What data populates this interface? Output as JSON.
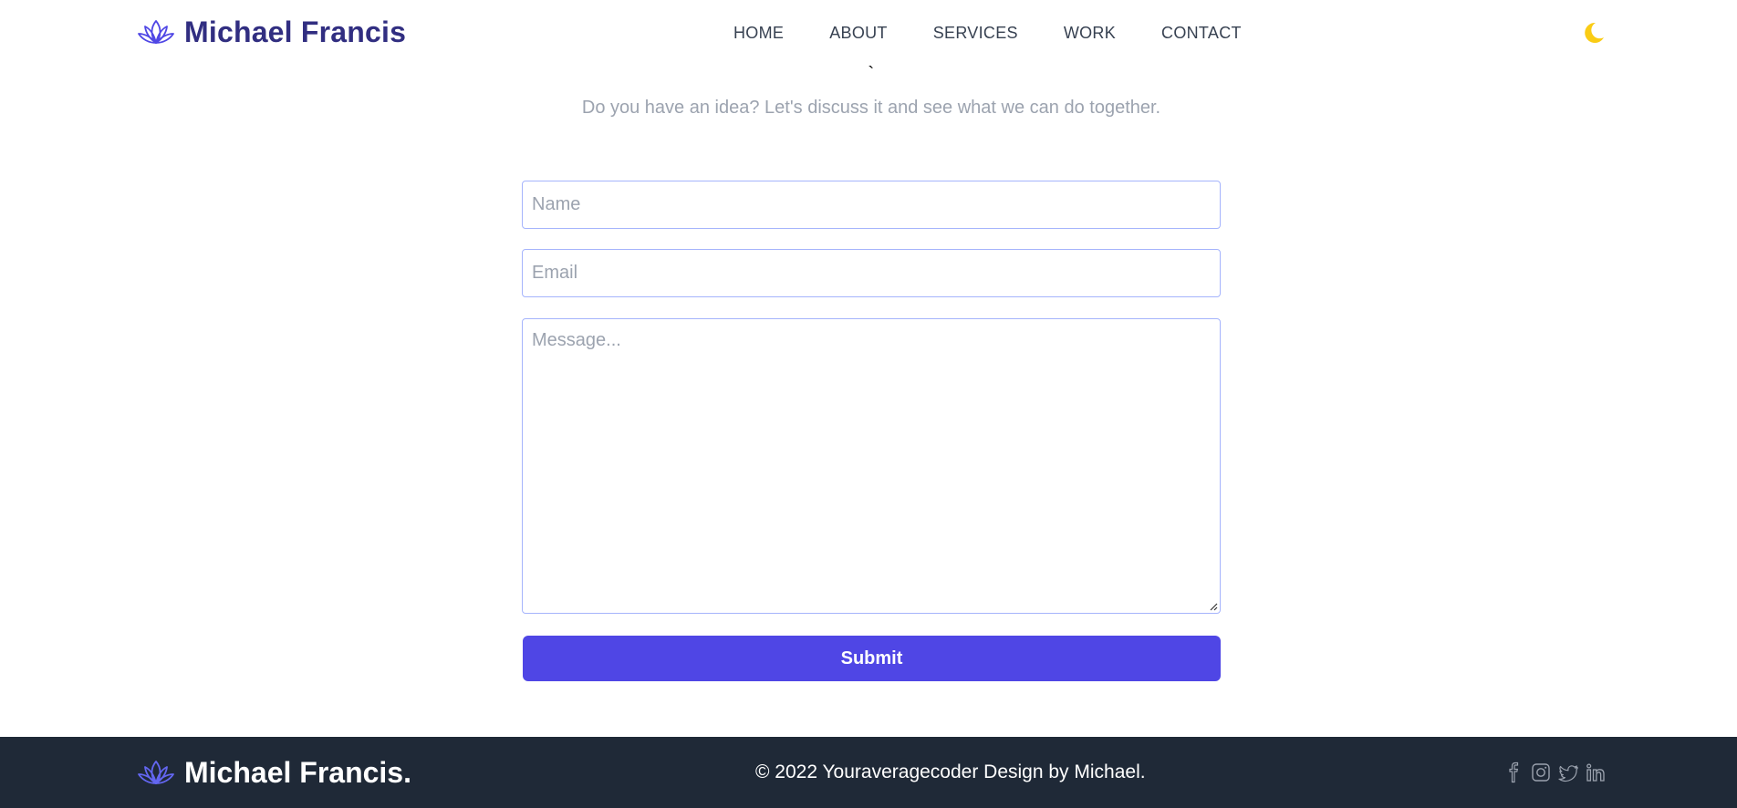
{
  "header": {
    "brand": "Michael Francis",
    "nav": [
      "HOME",
      "ABOUT",
      "SERVICES",
      "WORK",
      "CONTACT"
    ],
    "theme_toggle_icon": "moon-icon"
  },
  "contact": {
    "heading_fragment": "`",
    "subtitle": "Do you have an idea? Let's discuss it and see what we can do together.",
    "name_placeholder": "Name",
    "email_placeholder": "Email",
    "message_placeholder": "Message...",
    "submit_label": "Submit"
  },
  "footer": {
    "brand": "Michael Francis.",
    "copyright": "© 2022 Youraveragecoder Design by Michael.",
    "socials": [
      "facebook-icon",
      "instagram-icon",
      "twitter-icon",
      "linkedin-icon"
    ]
  },
  "colors": {
    "brand": "#312e81",
    "accent": "#4f46e5",
    "moon": "#facc15",
    "footer_bg": "#1f2937"
  }
}
